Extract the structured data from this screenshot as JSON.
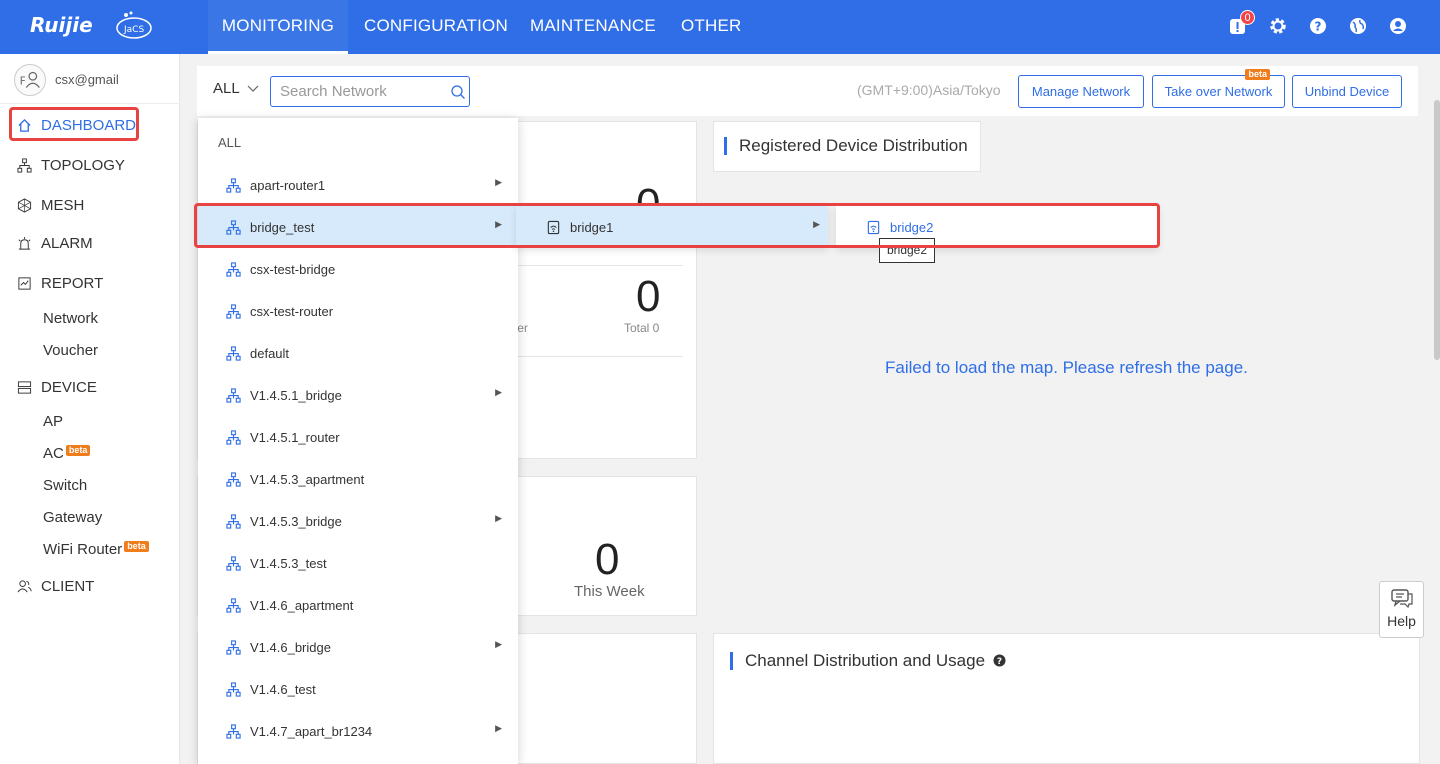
{
  "header": {
    "logo_text": "Ruijie",
    "logo_sub": "JaCS",
    "nav": [
      "MONITORING",
      "CONFIGURATION",
      "MAINTENANCE",
      "OTHER"
    ],
    "active_nav": "MONITORING",
    "notification_count": "0",
    "icons": [
      "notification-icon",
      "settings-icon",
      "help-icon",
      "language-icon",
      "user-icon"
    ],
    "brand_color": "#2f6ee6"
  },
  "sidebar": {
    "user_email": "csx@gmail",
    "items": [
      {
        "label": "DASHBOARD",
        "icon": "home-icon",
        "active": true
      },
      {
        "label": "TOPOLOGY",
        "icon": "topology-icon"
      },
      {
        "label": "MESH",
        "icon": "mesh-icon"
      },
      {
        "label": "ALARM",
        "icon": "alarm-icon"
      },
      {
        "label": "REPORT",
        "icon": "report-icon"
      },
      {
        "label": "Network"
      },
      {
        "label": "Voucher"
      },
      {
        "label": "DEVICE",
        "icon": "device-icon"
      },
      {
        "label": "AP"
      },
      {
        "label": "AC",
        "badge": "beta"
      },
      {
        "label": "Switch"
      },
      {
        "label": "Gateway"
      },
      {
        "label": "WiFi Router",
        "badge": "beta"
      },
      {
        "label": "CLIENT",
        "icon": "client-icon"
      }
    ]
  },
  "toolbar": {
    "scope": "ALL",
    "search_placeholder": "Search Network",
    "timezone": "(GMT+9:00)Asia/Tokyo",
    "buttons": [
      "Manage Network",
      "Take over Network",
      "Unbind Device"
    ],
    "take_over_badge": "beta"
  },
  "cards": {
    "device_big_top": "0",
    "device_total_value": "0",
    "device_total_label": "Total 0",
    "device_partial_label": "ter",
    "registered_title": "Registered Device Distribution",
    "map_error": "Failed to load the map. Please refresh the page.",
    "week_value": "0",
    "week_label": "This Week",
    "channel_title": "Channel Distribution and Usage"
  },
  "dropdown": {
    "all_label": "ALL",
    "items": [
      {
        "label": "apart-router1",
        "has_children": true
      },
      {
        "label": "bridge_test",
        "has_children": true,
        "selected": true
      },
      {
        "label": "csx-test-bridge",
        "has_children": false
      },
      {
        "label": "csx-test-router",
        "has_children": false
      },
      {
        "label": "default",
        "has_children": false
      },
      {
        "label": "V1.4.5.1_bridge",
        "has_children": true
      },
      {
        "label": "V1.4.5.1_router",
        "has_children": false
      },
      {
        "label": "V1.4.5.3_apartment",
        "has_children": false
      },
      {
        "label": "V1.4.5.3_bridge",
        "has_children": true
      },
      {
        "label": "V1.4.5.3_test",
        "has_children": false
      },
      {
        "label": "V1.4.6_apartment",
        "has_children": false
      },
      {
        "label": "V1.4.6_bridge",
        "has_children": true
      },
      {
        "label": "V1.4.6_test",
        "has_children": false
      },
      {
        "label": "V1.4.7_apart_br1234",
        "has_children": true
      }
    ],
    "level2": {
      "label": "bridge1",
      "has_children": true
    },
    "level3": {
      "label": "bridge2"
    },
    "tooltip": "bridge2"
  },
  "help": {
    "label": "Help"
  }
}
